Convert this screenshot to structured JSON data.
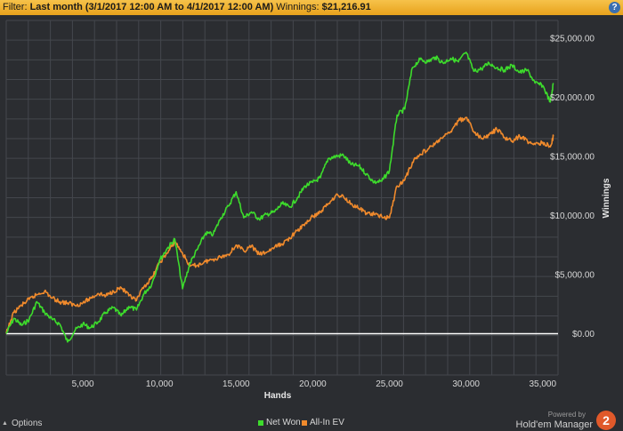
{
  "filter_bar": {
    "prefix": "Filter: ",
    "filter_value": "Last month (3/1/2017 12:00 AM to 4/1/2017 12:00 AM)",
    "winnings_label": " Winnings: ",
    "winnings_value": "$21,216.91",
    "help_icon": "?"
  },
  "footer": {
    "options_label": "Options",
    "powered_by": "Powered by",
    "brand": "Hold'em Manager",
    "logo_text": "2"
  },
  "colors": {
    "net_won": "#3ddb2c",
    "all_in_ev": "#f08a2c",
    "zero_line": "#ffffff",
    "grid": "#44474d"
  },
  "chart_data": {
    "type": "line",
    "xlabel": "Hands",
    "ylabel": "Winnings",
    "xlim": [
      0,
      36000
    ],
    "ylim": [
      -3500,
      26500
    ],
    "x_ticks": [
      5000,
      10000,
      15000,
      20000,
      25000,
      30000,
      35000
    ],
    "x_tick_labels": [
      "5,000",
      "10,000",
      "15,000",
      "20,000",
      "25,000",
      "30,000",
      "35,000"
    ],
    "y_ticks": [
      0,
      5000,
      10000,
      15000,
      20000,
      25000
    ],
    "y_tick_labels": [
      "$0.00",
      "$5,000.00",
      "$10,000.00",
      "$15,000.00",
      "$20,000.00",
      "$25,000.00"
    ],
    "grid": true,
    "legend_position": "bottom-center",
    "x": [
      0,
      500,
      1000,
      1500,
      2000,
      2500,
      3000,
      3500,
      4000,
      4500,
      5000,
      5500,
      6000,
      6500,
      7000,
      7500,
      8000,
      8500,
      9000,
      9500,
      10000,
      10500,
      11000,
      11500,
      12000,
      12500,
      13000,
      13500,
      14000,
      14500,
      15000,
      15500,
      16000,
      16500,
      17000,
      17500,
      18000,
      18500,
      19000,
      19500,
      20000,
      20500,
      21000,
      21500,
      22000,
      22500,
      23000,
      23500,
      24000,
      24500,
      25000,
      25500,
      26000,
      26500,
      27000,
      27500,
      28000,
      28500,
      29000,
      29500,
      30000,
      30500,
      31000,
      31500,
      32000,
      32500,
      33000,
      33500,
      34000,
      34500,
      35000,
      35500,
      35700
    ],
    "series": [
      {
        "name": "Net Won",
        "values": [
          0,
          1300,
          700,
          1200,
          2700,
          1800,
          1200,
          800,
          -700,
          300,
          800,
          500,
          1000,
          1800,
          2200,
          1500,
          2300,
          2000,
          3400,
          4200,
          6200,
          7200,
          8000,
          3800,
          6000,
          7200,
          8500,
          8400,
          9800,
          10800,
          12000,
          9800,
          10300,
          9700,
          10100,
          10300,
          11000,
          10700,
          11500,
          12500,
          12800,
          13200,
          14800,
          15000,
          15100,
          14300,
          14200,
          13500,
          12800,
          12900,
          13800,
          18500,
          19000,
          22500,
          23200,
          23000,
          23400,
          22900,
          23300,
          23000,
          23800,
          22200,
          22400,
          22900,
          22500,
          22300,
          22700,
          22100,
          22300,
          21200,
          21000,
          19600,
          21200
        ]
      },
      {
        "name": "All-In EV",
        "values": [
          0,
          1800,
          2400,
          2900,
          3300,
          3600,
          3000,
          2700,
          2600,
          2400,
          2600,
          3000,
          3400,
          3200,
          3600,
          3900,
          3200,
          2800,
          4000,
          4700,
          6000,
          6800,
          7800,
          6800,
          5700,
          5800,
          6100,
          6300,
          6500,
          6700,
          7500,
          7000,
          7400,
          6700,
          6900,
          7300,
          7600,
          8100,
          8700,
          9300,
          9900,
          10300,
          11000,
          11700,
          11600,
          11000,
          10600,
          10200,
          10100,
          9900,
          9800,
          12500,
          13000,
          14500,
          15200,
          15600,
          16100,
          16600,
          17100,
          18000,
          18300,
          17100,
          16500,
          16800,
          17300,
          16600,
          16300,
          16700,
          16300,
          16000,
          16200,
          15800,
          16700
        ]
      }
    ]
  }
}
